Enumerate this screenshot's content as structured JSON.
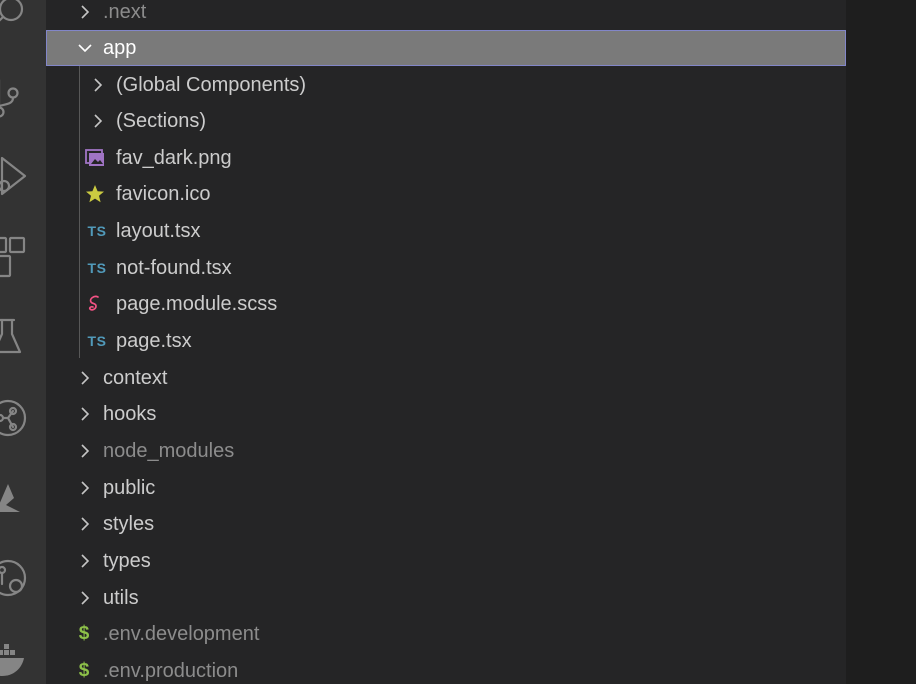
{
  "activity_bar": {
    "icons": [
      "search-icon",
      "source-control-icon",
      "run-debug-icon",
      "extensions-icon",
      "testing-icon",
      "git-graph-icon",
      "azure-icon",
      "remote-explorer-icon",
      "docker-icon"
    ]
  },
  "explorer": {
    "rows": [
      {
        "label": ".next",
        "type": "folder",
        "expanded": false,
        "depth": 0,
        "dimmed": true
      },
      {
        "label": "app",
        "type": "folder",
        "expanded": true,
        "depth": 0,
        "selected": true
      },
      {
        "label": "(Global Components)",
        "type": "folder",
        "expanded": false,
        "depth": 1
      },
      {
        "label": "(Sections)",
        "type": "folder",
        "expanded": false,
        "depth": 1
      },
      {
        "label": "fav_dark.png",
        "type": "file",
        "icon": "image-file-icon",
        "depth": 1
      },
      {
        "label": "favicon.ico",
        "type": "file",
        "icon": "star-icon",
        "depth": 1
      },
      {
        "label": "layout.tsx",
        "type": "file",
        "icon": "typescript-icon",
        "icon_text": "TS",
        "depth": 1
      },
      {
        "label": "not-found.tsx",
        "type": "file",
        "icon": "typescript-icon",
        "icon_text": "TS",
        "depth": 1
      },
      {
        "label": "page.module.scss",
        "type": "file",
        "icon": "sass-icon",
        "depth": 1
      },
      {
        "label": "page.tsx",
        "type": "file",
        "icon": "typescript-icon",
        "icon_text": "TS",
        "depth": 1
      },
      {
        "label": "context",
        "type": "folder",
        "expanded": false,
        "depth": 0
      },
      {
        "label": "hooks",
        "type": "folder",
        "expanded": false,
        "depth": 0
      },
      {
        "label": "node_modules",
        "type": "folder",
        "expanded": false,
        "depth": 0,
        "dimmed": true
      },
      {
        "label": "public",
        "type": "folder",
        "expanded": false,
        "depth": 0
      },
      {
        "label": "styles",
        "type": "folder",
        "expanded": false,
        "depth": 0
      },
      {
        "label": "types",
        "type": "folder",
        "expanded": false,
        "depth": 0
      },
      {
        "label": "utils",
        "type": "folder",
        "expanded": false,
        "depth": 0
      },
      {
        "label": ".env.development",
        "type": "file",
        "icon": "env-dollar-icon",
        "icon_text": "$",
        "depth": 0,
        "dimmed": true
      },
      {
        "label": ".env.production",
        "type": "file",
        "icon": "env-dollar-icon",
        "icon_text": "$",
        "depth": 0,
        "dimmed": true
      }
    ]
  },
  "colors": {
    "background": "#252526",
    "activity_bar": "#333333",
    "selected_row": "#7a7a7a",
    "selected_border": "#8286c9",
    "text": "#cccccc",
    "dimmed_text": "#8c8c8c",
    "ts_icon": "#519aba",
    "env_icon": "#8dc149",
    "star_icon": "#cbcb41",
    "sass_icon": "#f55385",
    "image_icon": "#a074c4"
  }
}
